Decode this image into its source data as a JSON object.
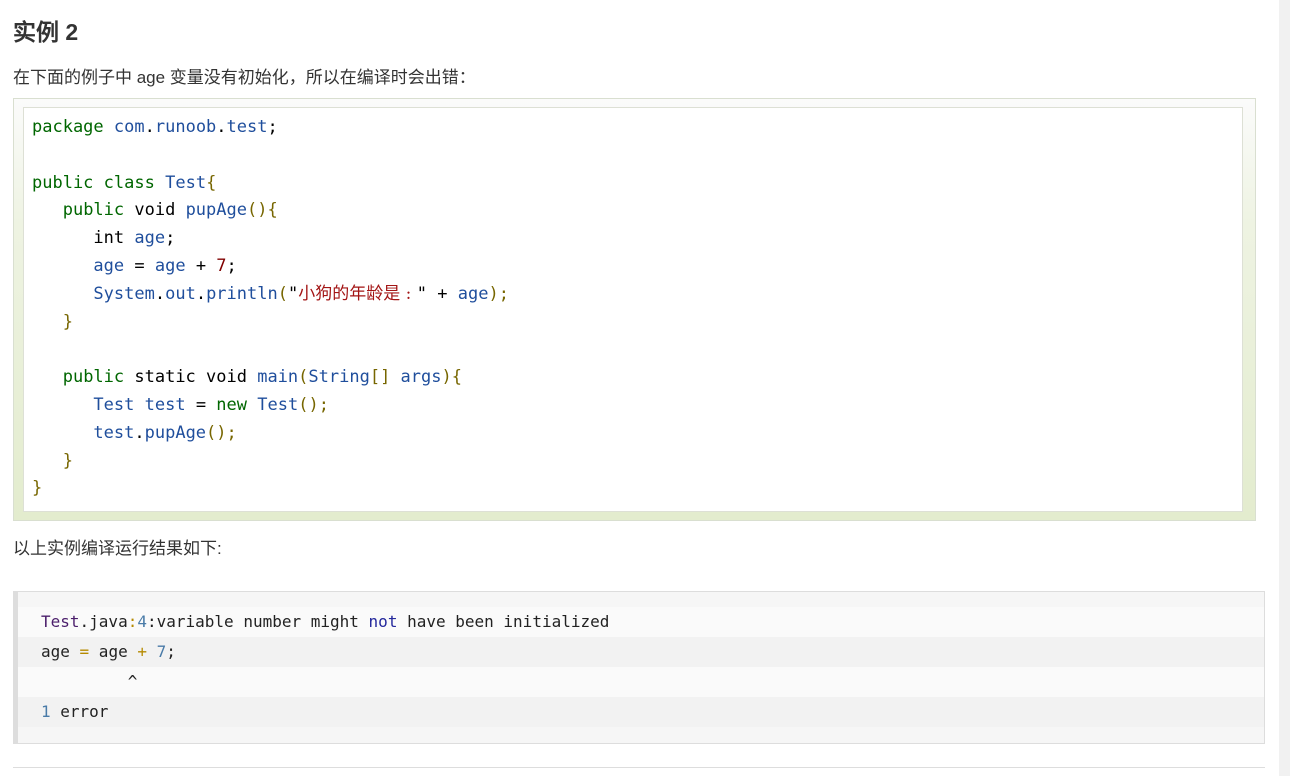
{
  "heading": "实例 2",
  "intro": "在下面的例子中 age 变量没有初始化，所以在编译时会出错：",
  "code": {
    "l1": [
      {
        "t": "package",
        "c": "kw"
      },
      {
        "t": " ",
        "c": ""
      },
      {
        "t": "com",
        "c": "fn"
      },
      {
        "t": ".",
        "c": ""
      },
      {
        "t": "runoob",
        "c": "fn"
      },
      {
        "t": ".",
        "c": ""
      },
      {
        "t": "test",
        "c": "fn"
      },
      {
        "t": ";",
        "c": ""
      }
    ],
    "l2": [],
    "l3": [
      {
        "t": "public",
        "c": "kw"
      },
      {
        "t": " ",
        "c": ""
      },
      {
        "t": "class",
        "c": "kw"
      },
      {
        "t": " ",
        "c": ""
      },
      {
        "t": "Test",
        "c": "fn"
      },
      {
        "t": "{",
        "c": "br"
      }
    ],
    "l4": [
      {
        "t": "   ",
        "c": ""
      },
      {
        "t": "public",
        "c": "kw"
      },
      {
        "t": " void ",
        "c": ""
      },
      {
        "t": "pupAge",
        "c": "fn"
      },
      {
        "t": "(){",
        "c": "br"
      }
    ],
    "l5": [
      {
        "t": "      int ",
        "c": ""
      },
      {
        "t": "age",
        "c": "fn"
      },
      {
        "t": ";",
        "c": ""
      }
    ],
    "l6": [
      {
        "t": "      ",
        "c": ""
      },
      {
        "t": "age",
        "c": "fn"
      },
      {
        "t": " = ",
        "c": ""
      },
      {
        "t": "age",
        "c": "fn"
      },
      {
        "t": " + ",
        "c": ""
      },
      {
        "t": "7",
        "c": "num"
      },
      {
        "t": ";",
        "c": ""
      }
    ],
    "l7": [
      {
        "t": "      ",
        "c": ""
      },
      {
        "t": "System",
        "c": "fn"
      },
      {
        "t": ".",
        "c": ""
      },
      {
        "t": "out",
        "c": "fn"
      },
      {
        "t": ".",
        "c": ""
      },
      {
        "t": "println",
        "c": "fn"
      },
      {
        "t": "(",
        "c": "br"
      },
      {
        "t": "\"",
        "c": ""
      },
      {
        "t": "小狗的年龄是 : ",
        "c": "str"
      },
      {
        "t": "\"",
        "c": ""
      },
      {
        "t": " + ",
        "c": ""
      },
      {
        "t": "age",
        "c": "fn"
      },
      {
        "t": ");",
        "c": "br"
      }
    ],
    "l8": [
      {
        "t": "   ",
        "c": ""
      },
      {
        "t": "}",
        "c": "br"
      }
    ],
    "l9": [],
    "l10": [
      {
        "t": "   ",
        "c": ""
      },
      {
        "t": "public",
        "c": "kw"
      },
      {
        "t": " static void ",
        "c": ""
      },
      {
        "t": "main",
        "c": "fn"
      },
      {
        "t": "(",
        "c": "br"
      },
      {
        "t": "String",
        "c": "fn"
      },
      {
        "t": "[] ",
        "c": "br"
      },
      {
        "t": "args",
        "c": "fn"
      },
      {
        "t": "){",
        "c": "br"
      }
    ],
    "l11": [
      {
        "t": "      ",
        "c": ""
      },
      {
        "t": "Test",
        "c": "fn"
      },
      {
        "t": " ",
        "c": ""
      },
      {
        "t": "test",
        "c": "fn"
      },
      {
        "t": " = ",
        "c": ""
      },
      {
        "t": "new",
        "c": "kw"
      },
      {
        "t": " ",
        "c": ""
      },
      {
        "t": "Test",
        "c": "fn"
      },
      {
        "t": "();",
        "c": "br"
      }
    ],
    "l12": [
      {
        "t": "      ",
        "c": ""
      },
      {
        "t": "test",
        "c": "fn"
      },
      {
        "t": ".",
        "c": ""
      },
      {
        "t": "pupAge",
        "c": "fn"
      },
      {
        "t": "();",
        "c": "br"
      }
    ],
    "l13": [
      {
        "t": "   ",
        "c": ""
      },
      {
        "t": "}",
        "c": "br"
      }
    ],
    "l14": [
      {
        "t": "}",
        "c": "br"
      }
    ]
  },
  "result_intro": "以上实例编译运行结果如下:",
  "output": {
    "o1": [
      {
        "t": "Test",
        "c": "o-cls"
      },
      {
        "t": ".java",
        "c": ""
      },
      {
        "t": ":",
        "c": "o-op"
      },
      {
        "t": "4",
        "c": "o-num"
      },
      {
        "t": ":variable number might ",
        "c": ""
      },
      {
        "t": "not",
        "c": "o-kw"
      },
      {
        "t": " have been initialized",
        "c": ""
      }
    ],
    "o2": [
      {
        "t": "age ",
        "c": ""
      },
      {
        "t": "=",
        "c": "o-op"
      },
      {
        "t": " age ",
        "c": ""
      },
      {
        "t": "+",
        "c": "o-op"
      },
      {
        "t": " ",
        "c": ""
      },
      {
        "t": "7",
        "c": "o-num"
      },
      {
        "t": ";",
        "c": ""
      }
    ],
    "o3": [
      {
        "t": "         ^",
        "c": ""
      }
    ],
    "o4": [
      {
        "t": "1",
        "c": "o-num"
      },
      {
        "t": " error",
        "c": ""
      }
    ]
  }
}
